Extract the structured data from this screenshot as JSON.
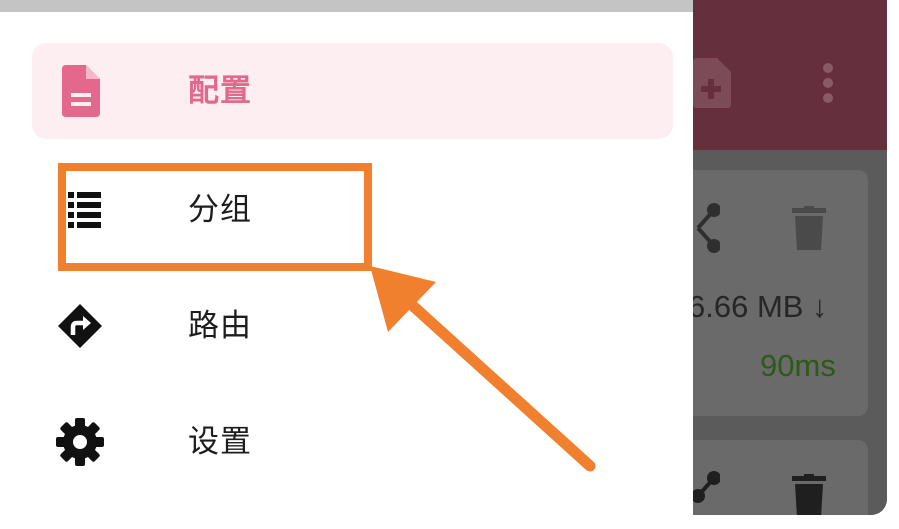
{
  "drawer": {
    "items": [
      {
        "label": "配置",
        "icon": "document-icon",
        "active": true
      },
      {
        "label": "分组",
        "icon": "list-icon",
        "active": false
      },
      {
        "label": "路由",
        "icon": "route-sign-icon",
        "active": false
      },
      {
        "label": "设置",
        "icon": "gear-icon",
        "active": false
      }
    ]
  },
  "background_app": {
    "toolbar_icons": [
      "add-document-icon",
      "more-vert-icon"
    ],
    "card": {
      "traffic": "6.66 MB ↓",
      "latency": "90ms",
      "icons": [
        "share-icon",
        "trash-icon"
      ]
    }
  },
  "colors": {
    "accent": "#e2698c",
    "active_bg": "#fdeef2",
    "toolbar": "#652f3e",
    "annotation": "#f07f2e",
    "latency_green": "#2c5a17"
  }
}
